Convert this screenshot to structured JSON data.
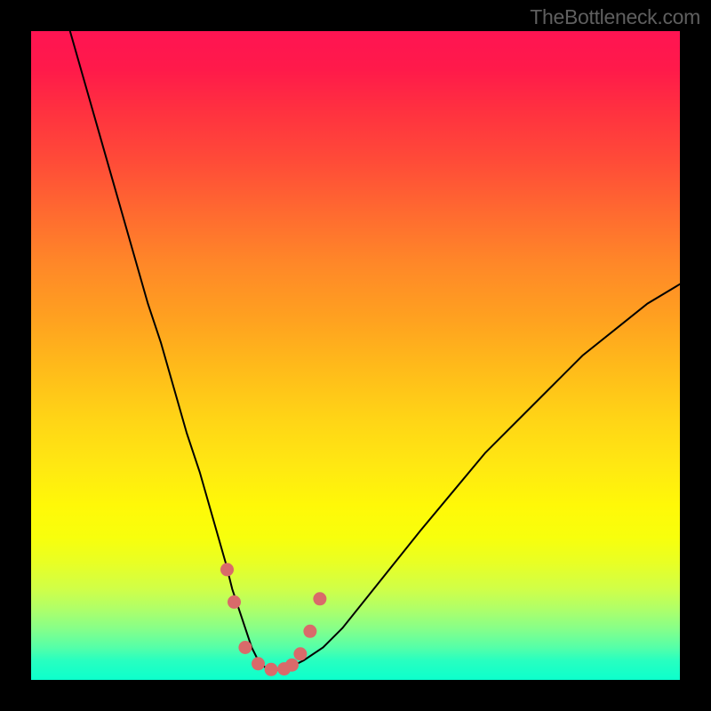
{
  "watermark": "TheBottleneck.com",
  "chart_data": {
    "type": "line",
    "title": "",
    "xlabel": "",
    "ylabel": "",
    "xlim": [
      0,
      100
    ],
    "ylim": [
      0,
      100
    ],
    "series": [
      {
        "name": "curve",
        "color": "#000000",
        "x": [
          6,
          8,
          10,
          12,
          14,
          16,
          18,
          20,
          22,
          24,
          26,
          28,
          30,
          31,
          32,
          33,
          34,
          35,
          36,
          37,
          38,
          40,
          42,
          45,
          48,
          52,
          56,
          60,
          65,
          70,
          75,
          80,
          85,
          90,
          95,
          100
        ],
        "y": [
          100,
          93,
          86,
          79,
          72,
          65,
          58,
          52,
          45,
          38,
          32,
          25,
          18,
          14,
          11,
          8,
          5,
          3,
          2,
          1.5,
          1.5,
          2,
          3,
          5,
          8,
          13,
          18,
          23,
          29,
          35,
          40,
          45,
          50,
          54,
          58,
          61
        ]
      }
    ],
    "markers": {
      "name": "highlight-dots",
      "color": "#d96a6a",
      "x": [
        30.2,
        31.3,
        33.0,
        35.0,
        37.0,
        39.0,
        40.2,
        41.5,
        43.0,
        44.5
      ],
      "y": [
        17.0,
        12.0,
        5.0,
        2.5,
        1.6,
        1.7,
        2.3,
        4.0,
        7.5,
        12.5
      ]
    },
    "gradient_note": "vertical red-to-green heatmap background; lower y = greener (better)"
  }
}
